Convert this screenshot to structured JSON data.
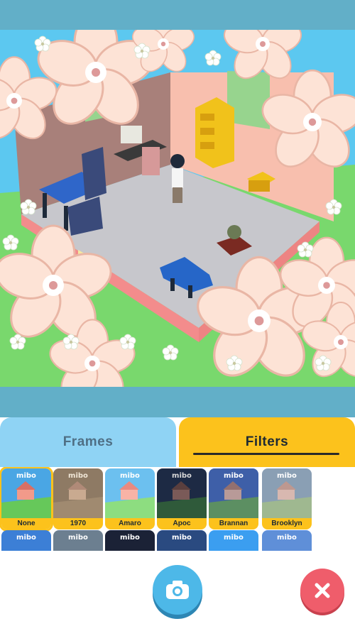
{
  "tabs": {
    "frames": "Frames",
    "filters": "Filters",
    "active": "Filters"
  },
  "filters": [
    {
      "name": "None",
      "selected": true
    },
    {
      "name": "1970",
      "selected": false
    },
    {
      "name": "Amaro",
      "selected": false
    },
    {
      "name": "Apoc",
      "selected": false
    },
    {
      "name": "Brannan",
      "selected": false
    },
    {
      "name": "Brooklyn",
      "selected": false
    }
  ],
  "thumbnail_logo": "mibo",
  "icons": {
    "capture": "camera-icon",
    "close": "close-x-icon",
    "flower": "cherry-blossom"
  },
  "colors": {
    "top_bar": "#62afc8",
    "frames_tab": "#8fd3f4",
    "filters_tab": "#fcc21c",
    "camera_button": "#4db8e8",
    "close_button": "#ef5d6b"
  }
}
